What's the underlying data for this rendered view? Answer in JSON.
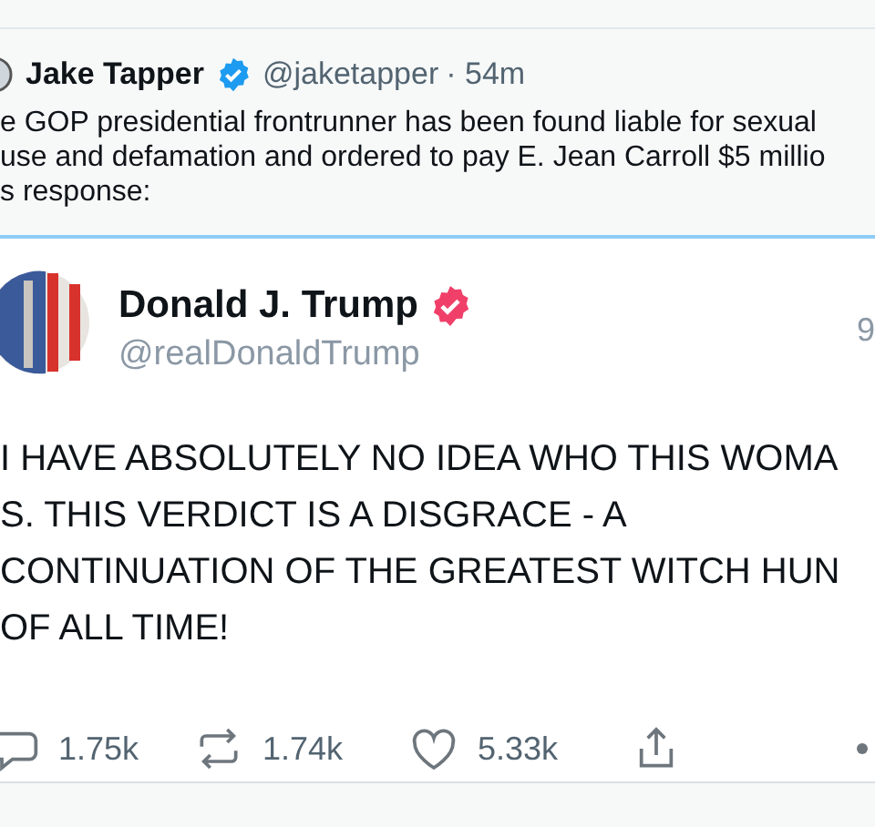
{
  "quote_tweet": {
    "author": "Jake Tapper",
    "verified": true,
    "handle": "@jaketapper",
    "time": "· 54m",
    "lines": [
      "e GOP presidential frontrunner has been found liable for sexual",
      "use and defamation and ordered to pay E. Jean Carroll $5 millio",
      "s response:"
    ]
  },
  "embedded_tweet": {
    "author": "Donald J. Trump",
    "verified": true,
    "handle": "@realDonaldTrump",
    "time": "9",
    "lines": [
      "I HAVE ABSOLUTELY NO IDEA WHO THIS WOMA",
      "S. THIS VERDICT IS A DISGRACE - A",
      "CONTINUATION OF THE GREATEST WITCH HUN",
      "OF ALL TIME!"
    ],
    "actions": [
      {
        "kind": "reply",
        "count": "1.75k"
      },
      {
        "kind": "repost",
        "count": "1.74k"
      },
      {
        "kind": "like",
        "count": "5.33k"
      },
      {
        "kind": "share"
      },
      {
        "kind": "more"
      }
    ]
  }
}
